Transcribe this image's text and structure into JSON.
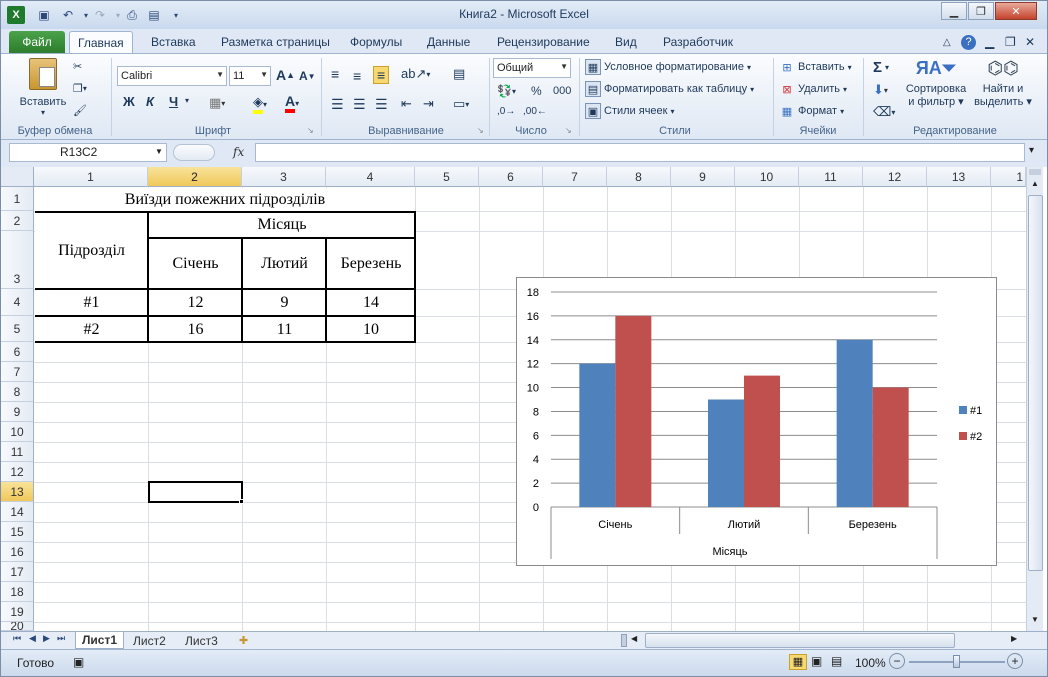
{
  "titlebar": {
    "title": "Книга2  -  Microsoft Excel"
  },
  "tabs": [
    "Файл",
    "Главная",
    "Вставка",
    "Разметка страницы",
    "Формулы",
    "Данные",
    "Рецензирование",
    "Вид",
    "Разработчик"
  ],
  "ribbon": {
    "clipboard": {
      "label": "Буфер обмена",
      "paste": "Вставить"
    },
    "font": {
      "label": "Шрифт",
      "name": "Calibri",
      "size": "11",
      "bold": "Ж",
      "italic": "К",
      "underline": "Ч"
    },
    "alignment": {
      "label": "Выравнивание"
    },
    "number": {
      "label": "Число",
      "format": "Общий",
      "percent": "%",
      "thousands": "000"
    },
    "styles": {
      "label": "Стили",
      "conditional": "Условное форматирование",
      "as_table": "Форматировать как таблицу",
      "cell_styles": "Стили ячеек"
    },
    "cells": {
      "label": "Ячейки",
      "insert": "Вставить",
      "delete": "Удалить",
      "format": "Формат"
    },
    "editing": {
      "label": "Редактирование",
      "sigma": "Σ",
      "sort": "Сортировка",
      "sort2": "и фильтр",
      "find": "Найти и",
      "find2": "выделить"
    }
  },
  "formula_bar": {
    "name_box": "R13C2",
    "fx": "fx",
    "formula": ""
  },
  "columns": [
    "1",
    "2",
    "3",
    "4",
    "5",
    "6",
    "7",
    "8",
    "9",
    "10",
    "11",
    "12",
    "13",
    "1"
  ],
  "rows": [
    "1",
    "2",
    "3",
    "4",
    "5",
    "6",
    "7",
    "8",
    "9",
    "10",
    "11",
    "12",
    "13",
    "14",
    "15",
    "16",
    "17",
    "18",
    "19",
    "20"
  ],
  "table": {
    "title": "Виїзди пожежних підрозділів",
    "header_unit": "Підрозділ",
    "header_month": "Місяць",
    "months": [
      "Січень",
      "Лютий",
      "Березень"
    ],
    "rows": [
      {
        "unit": "#1",
        "values": [
          "12",
          "9",
          "14"
        ]
      },
      {
        "unit": "#2",
        "values": [
          "16",
          "11",
          "10"
        ]
      }
    ]
  },
  "chart_data": {
    "type": "bar",
    "categories": [
      "Січень",
      "Лютий",
      "Березень"
    ],
    "series": [
      {
        "name": "#1",
        "values": [
          12,
          9,
          14
        ],
        "color": "#4f81bd"
      },
      {
        "name": "#2",
        "values": [
          16,
          11,
          10
        ],
        "color": "#c0504d"
      }
    ],
    "title": "",
    "xlabel": "Місяць",
    "ylabel": "",
    "ylim": [
      0,
      18
    ],
    "yticks": [
      0,
      2,
      4,
      6,
      8,
      10,
      12,
      14,
      16,
      18
    ],
    "grid": true,
    "legend": "right"
  },
  "sheets": [
    "Лист1",
    "Лист2",
    "Лист3"
  ],
  "status": {
    "ready": "Готово",
    "zoom": "100%"
  }
}
